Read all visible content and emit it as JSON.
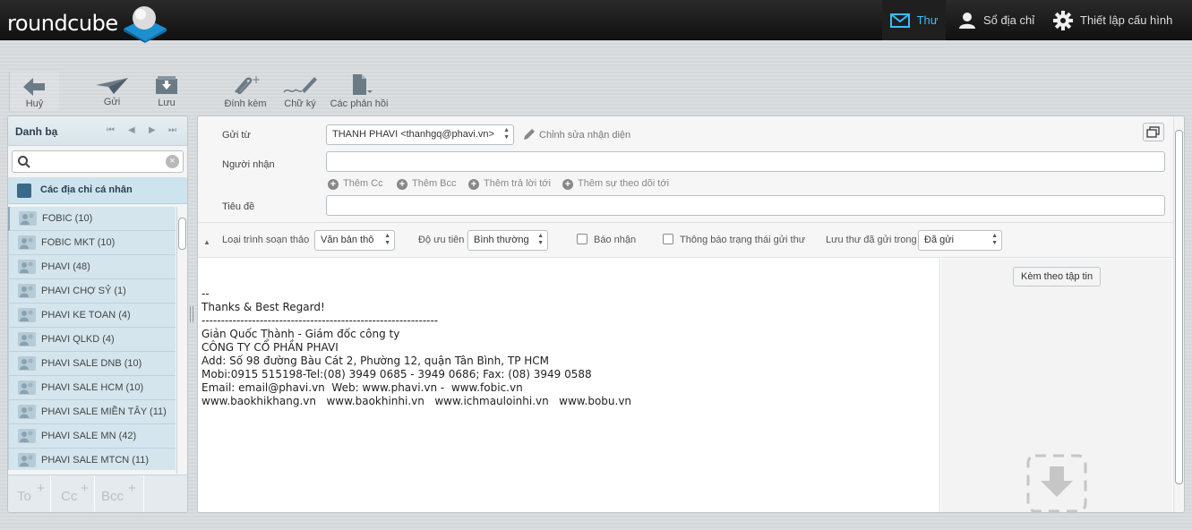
{
  "app": {
    "logo_text": "roundcube"
  },
  "topnav": {
    "mail": "Thư",
    "contacts": "Sổ địa chỉ",
    "settings": "Thiết lập cấu hình"
  },
  "toolbar": {
    "cancel": "Huỷ",
    "send": "Gửi",
    "save": "Lưu",
    "attach": "Đính kèm",
    "signature": "Chữ ký",
    "responses": "Các phản hồi"
  },
  "left_panel": {
    "title": "Danh bạ",
    "search_placeholder": "",
    "address_book": "Các địa chỉ cá nhân",
    "contacts": [
      {
        "label": "FOBIC (10)"
      },
      {
        "label": "FOBIC MKT (10)"
      },
      {
        "label": "PHAVI (48)"
      },
      {
        "label": "PHAVI CHỢ SỶ (1)"
      },
      {
        "label": "PHAVI KE TOAN (4)"
      },
      {
        "label": "PHAVI QLKD (4)"
      },
      {
        "label": "PHAVI SALE DNB (10)"
      },
      {
        "label": "PHAVI SALE HCM (10)"
      },
      {
        "label": "PHAVI SALE MIỀN TÂY (11)"
      },
      {
        "label": "PHAVI SALE MN (42)"
      },
      {
        "label": "PHAVI SALE MTCN (11)"
      }
    ],
    "footer": {
      "to": "To",
      "cc": "Cc",
      "bcc": "Bcc",
      "plus": "+"
    }
  },
  "compose": {
    "from_label": "Gửi từ",
    "from_value": "THANH PHAVI <thanhgq@phavi.vn>",
    "edit_identity": "Chỉnh sửa nhận diện",
    "to_label": "Người nhận",
    "to_value": "",
    "add_cc": "Thêm Cc",
    "add_bcc": "Thêm Bcc",
    "add_reply_to": "Thêm trả lời tới",
    "add_followup_to": "Thêm sự theo dõi tới",
    "subject_label": "Tiêu đề",
    "subject_value": "",
    "editor_type_label": "Loại trình soạn thảo",
    "editor_type_value": "Văn bản thô",
    "priority_label": "Độ ưu tiên",
    "priority_value": "Bình thường",
    "receipt_label": "Báo nhận",
    "dsn_label": "Thông báo trạng thái gửi thư",
    "save_sent_label": "Lưu thư đã gửi trong",
    "save_sent_value": "Đã gửi",
    "attach_button": "Kèm theo tập tin",
    "body": "--\nThanks & Best Regard!\n-------------------------------------------------------------\nGiản Quốc Thành - Giám đốc công ty\nCÔNG TY CỔ PHẦN PHAVI\nAdd: Số 98 đường Bàu Cát 2, Phường 12, quận Tân Bình, TP HCM\nMobi:0915 515198-Tel:(08) 3949 0685 - 3949 0686; Fax: (08) 3949 0588\nEmail: email@phavi.vn  Web: www.phavi.vn -  www.fobic.vn\nwww.baokhikhang.vn   www.baokhinhi.vn   www.ichmauloinhi.vn   www.bobu.vn"
  },
  "colors": {
    "accent": "#37beff",
    "topbar": "#161616",
    "list_bg": "#d4e5ee"
  }
}
